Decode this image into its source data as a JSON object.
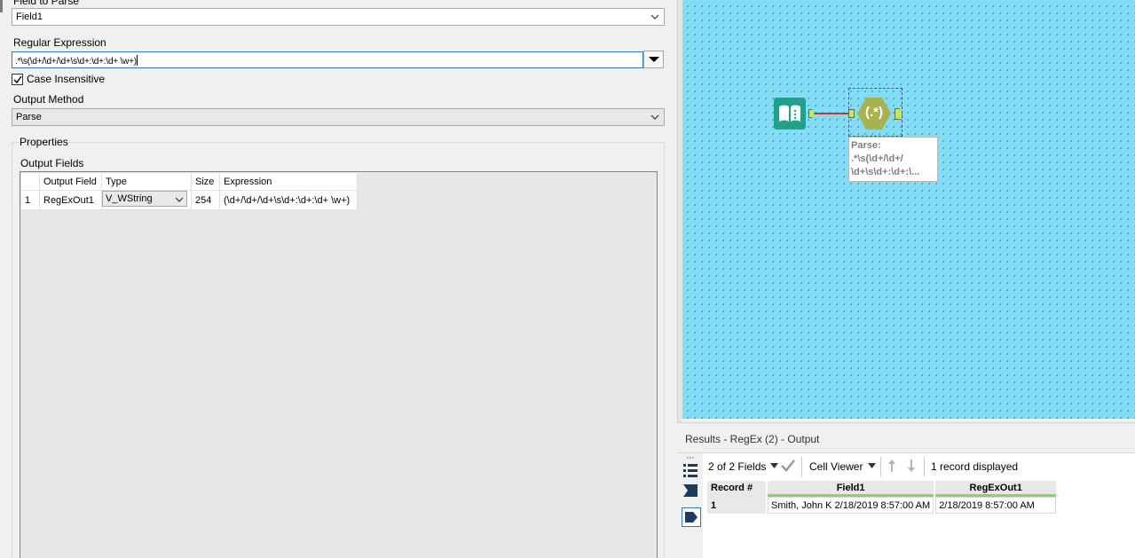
{
  "config": {
    "field_to_parse_label": "Field to Parse",
    "field_to_parse_value": "Field1",
    "regex_label": "Regular Expression",
    "regex_value": ".*\\s(\\d+/\\d+/\\d+\\s\\d+:\\d+:\\d+ \\w+)",
    "case_insensitive_label": "Case Insensitive",
    "case_insensitive_checked": true,
    "output_method_label": "Output Method",
    "output_method_value": "Parse",
    "properties_label": "Properties",
    "output_fields_label": "Output Fields",
    "grid": {
      "headers": [
        "Output Field",
        "Type",
        "Size",
        "Expression"
      ],
      "rows": [
        {
          "num": "1",
          "field": "RegExOut1",
          "type": "V_WString",
          "size": "254",
          "expression": "(\\d+/\\d+/\\d+\\s\\d+:\\d+:\\d+ \\w+)"
        }
      ]
    }
  },
  "canvas": {
    "annotation_lines": [
      "Parse:",
      ".*\\s(\\d+/\\d+/",
      "\\d+\\s\\d+:\\d+:\\..."
    ],
    "regex_tool_glyph": "(.*)",
    "input_tool_icon": "book-icon",
    "background_color": "#85dcf6"
  },
  "results": {
    "title": "Results - RegEx (2) - Output",
    "fields_selector": "2 of 2 Fields",
    "cell_viewer": "Cell Viewer",
    "record_count": "1 record displayed",
    "columns": [
      "Record #",
      "Field1",
      "RegExOut1"
    ],
    "rows": [
      {
        "record": "1",
        "field1": "Smith, John K 2/18/2019 8:57:00 AM",
        "regexout1": "2/18/2019 8:57:00 AM"
      }
    ]
  }
}
